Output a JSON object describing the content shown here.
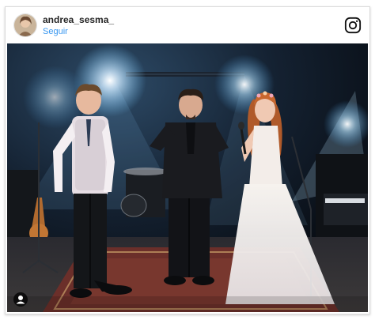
{
  "post": {
    "username": "andrea_sesma_",
    "follow_label": "Seguir"
  },
  "icons": {
    "brand": "instagram-icon",
    "tag": "user-tag-icon"
  },
  "colors": {
    "follow_link": "#3897f0",
    "username_text": "#262626",
    "stage_light": "#6ec6ff"
  }
}
